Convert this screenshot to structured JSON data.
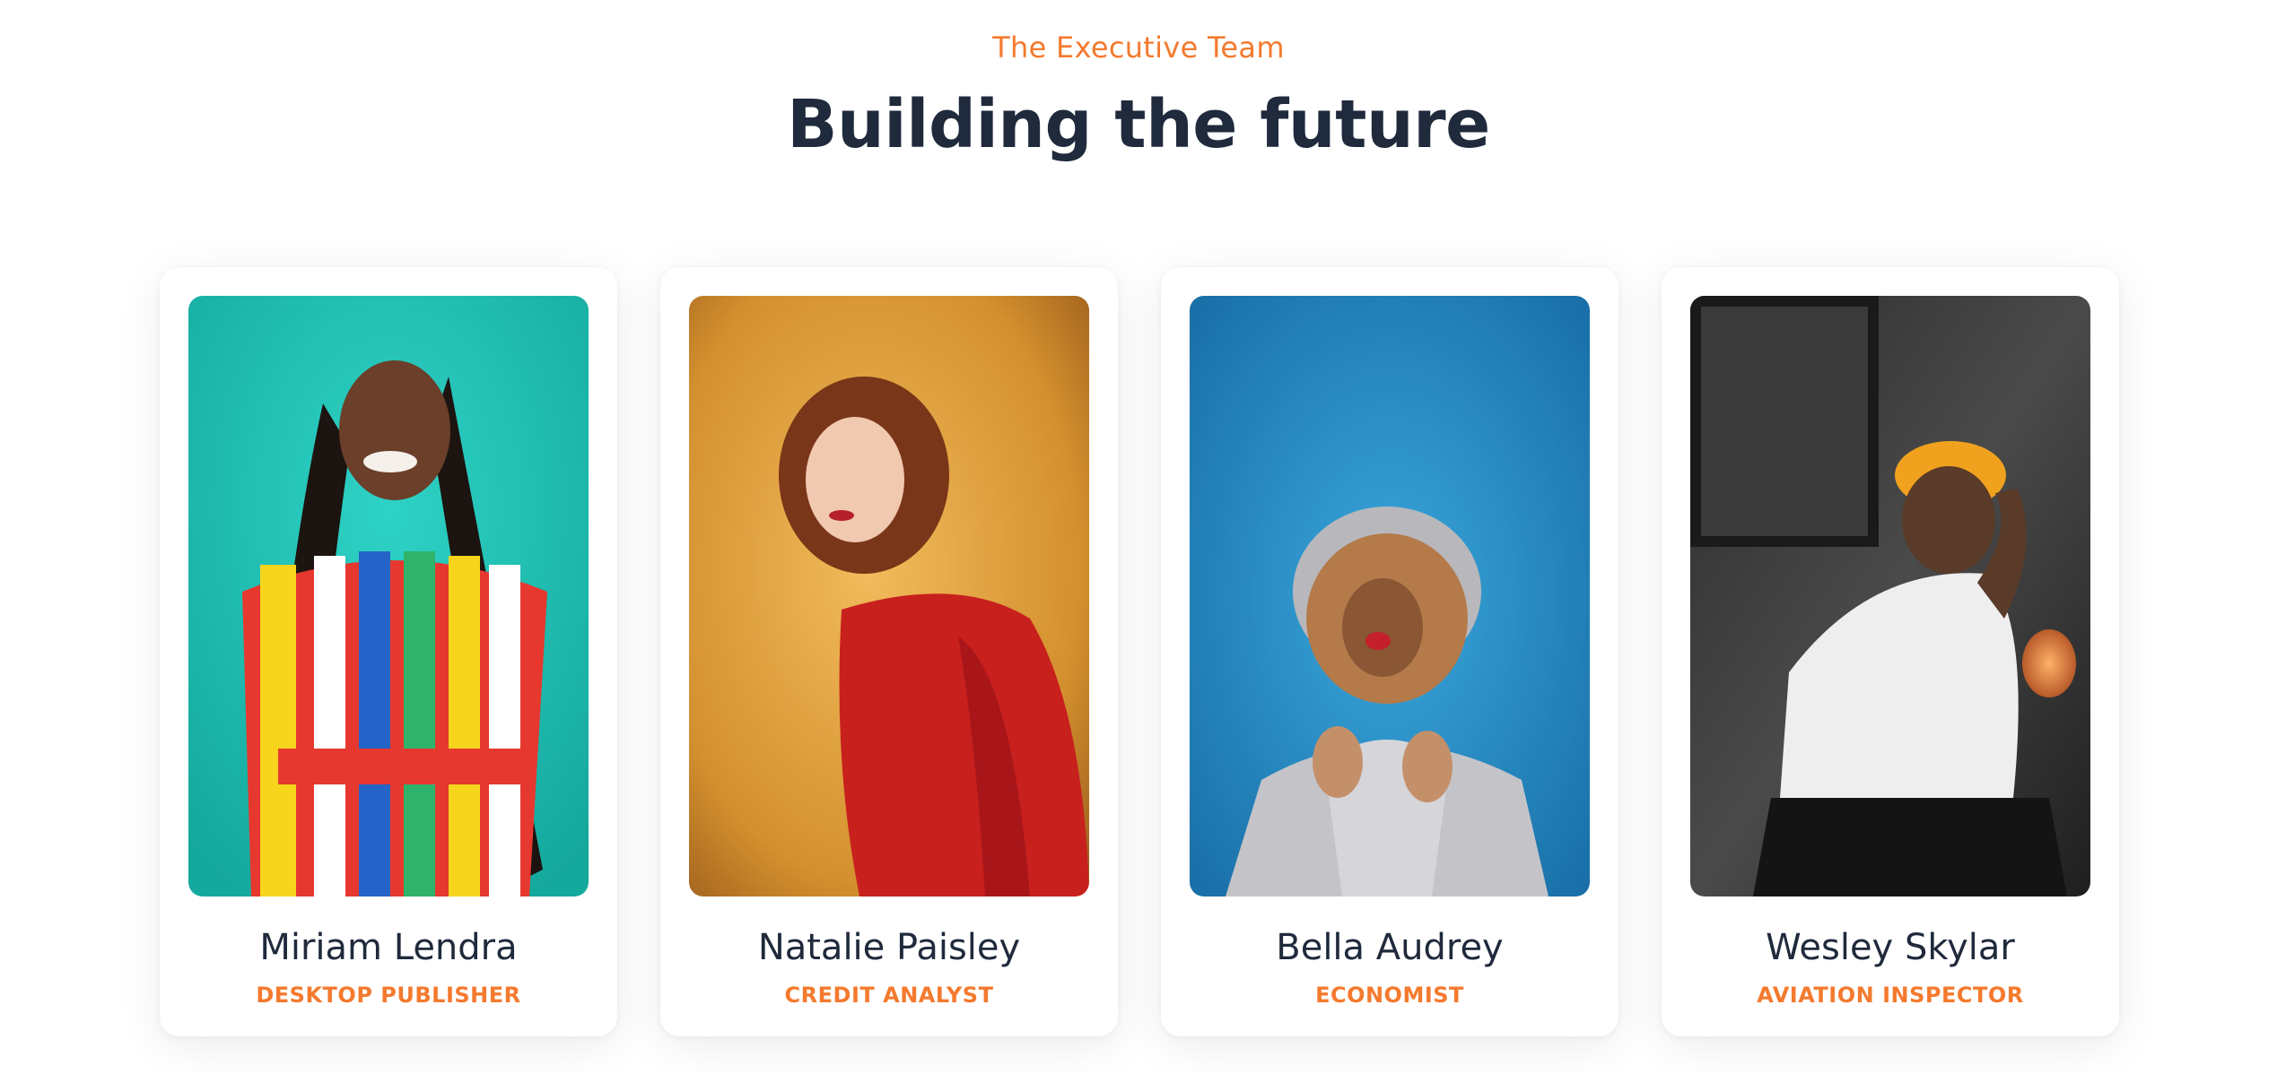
{
  "header": {
    "eyebrow": "The Executive Team",
    "title": "Building the future"
  },
  "team": [
    {
      "name": "Miriam Lendra",
      "role": "DESKTOP PUBLISHER",
      "photo_bg": "#1fc3b4"
    },
    {
      "name": "Natalie Paisley",
      "role": "CREDIT ANALYST",
      "photo_bg": "#d99a3c"
    },
    {
      "name": "Bella Audrey",
      "role": "ECONOMIST",
      "photo_bg": "#2389c3"
    },
    {
      "name": "Wesley Skylar",
      "role": "AVIATION INSPECTOR",
      "photo_bg": "#3a3a3a"
    }
  ],
  "colors": {
    "accent": "#f47a2e",
    "heading": "#1f2a3c",
    "background": "#ffffff"
  }
}
